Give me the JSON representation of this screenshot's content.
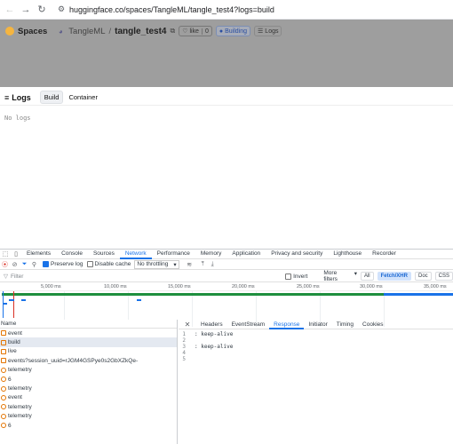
{
  "browser": {
    "url": "huggingface.co/spaces/TangleML/tangle_test4?logs=build"
  },
  "hf": {
    "spaces_label": "Spaces",
    "owner": "TangleML",
    "separator": "/",
    "repo": "tangle_test4",
    "like_label": "like",
    "like_count": "0",
    "status_label": "Building",
    "logs_chip_label": "Logs"
  },
  "logs": {
    "title": "Logs",
    "tabs": [
      "Build",
      "Container"
    ],
    "empty_text": "No logs"
  },
  "devtools": {
    "tabs": [
      "Elements",
      "Console",
      "Sources",
      "Network",
      "Performance",
      "Memory",
      "Application",
      "Privacy and security",
      "Lighthouse",
      "Recorder"
    ],
    "selected_tab": "Network",
    "preserve_log_label": "Preserve log",
    "disable_cache_label": "Disable cache",
    "throttle_value": "No throttling",
    "filter_placeholder": "Filter",
    "invert_label": "Invert",
    "more_filters_label": "More filters",
    "type_filters": [
      "All",
      "Fetch/XHR",
      "Doc",
      "CSS"
    ],
    "selected_type_filter": "Fetch/XHR",
    "ruler_ticks": [
      "5,000 ms",
      "10,000 ms",
      "15,000 ms",
      "20,000 ms",
      "25,000 ms",
      "30,000 ms",
      "35,000 ms"
    ],
    "name_column": "Name",
    "requests": [
      {
        "name": "event",
        "icon": "xhr-icon"
      },
      {
        "name": "build",
        "icon": "xhr-icon"
      },
      {
        "name": "live",
        "icon": "xhr-icon"
      },
      {
        "name": "events?session_uuid=rJGM4GSPye0s2GbXZkQe-",
        "icon": "xhr-icon"
      },
      {
        "name": "telemetry",
        "icon": "websocket-icon"
      },
      {
        "name": "6",
        "icon": "websocket-icon"
      },
      {
        "name": "telemetry",
        "icon": "websocket-icon"
      },
      {
        "name": "event",
        "icon": "websocket-icon"
      },
      {
        "name": "telemetry",
        "icon": "websocket-icon"
      },
      {
        "name": "telemetry",
        "icon": "websocket-icon"
      },
      {
        "name": "6",
        "icon": "websocket-icon"
      }
    ],
    "selected_request_index": 1,
    "response_tabs": [
      "Headers",
      "EventStream",
      "Response",
      "Initiator",
      "Timing",
      "Cookies"
    ],
    "selected_response_tab": "Response",
    "response_lines": [
      {
        "n": "1",
        "text": ": keep-alive"
      },
      {
        "n": "2",
        "text": ""
      },
      {
        "n": "3",
        "text": ": keep-alive"
      },
      {
        "n": "4",
        "text": ""
      },
      {
        "n": "5",
        "text": ""
      }
    ]
  }
}
